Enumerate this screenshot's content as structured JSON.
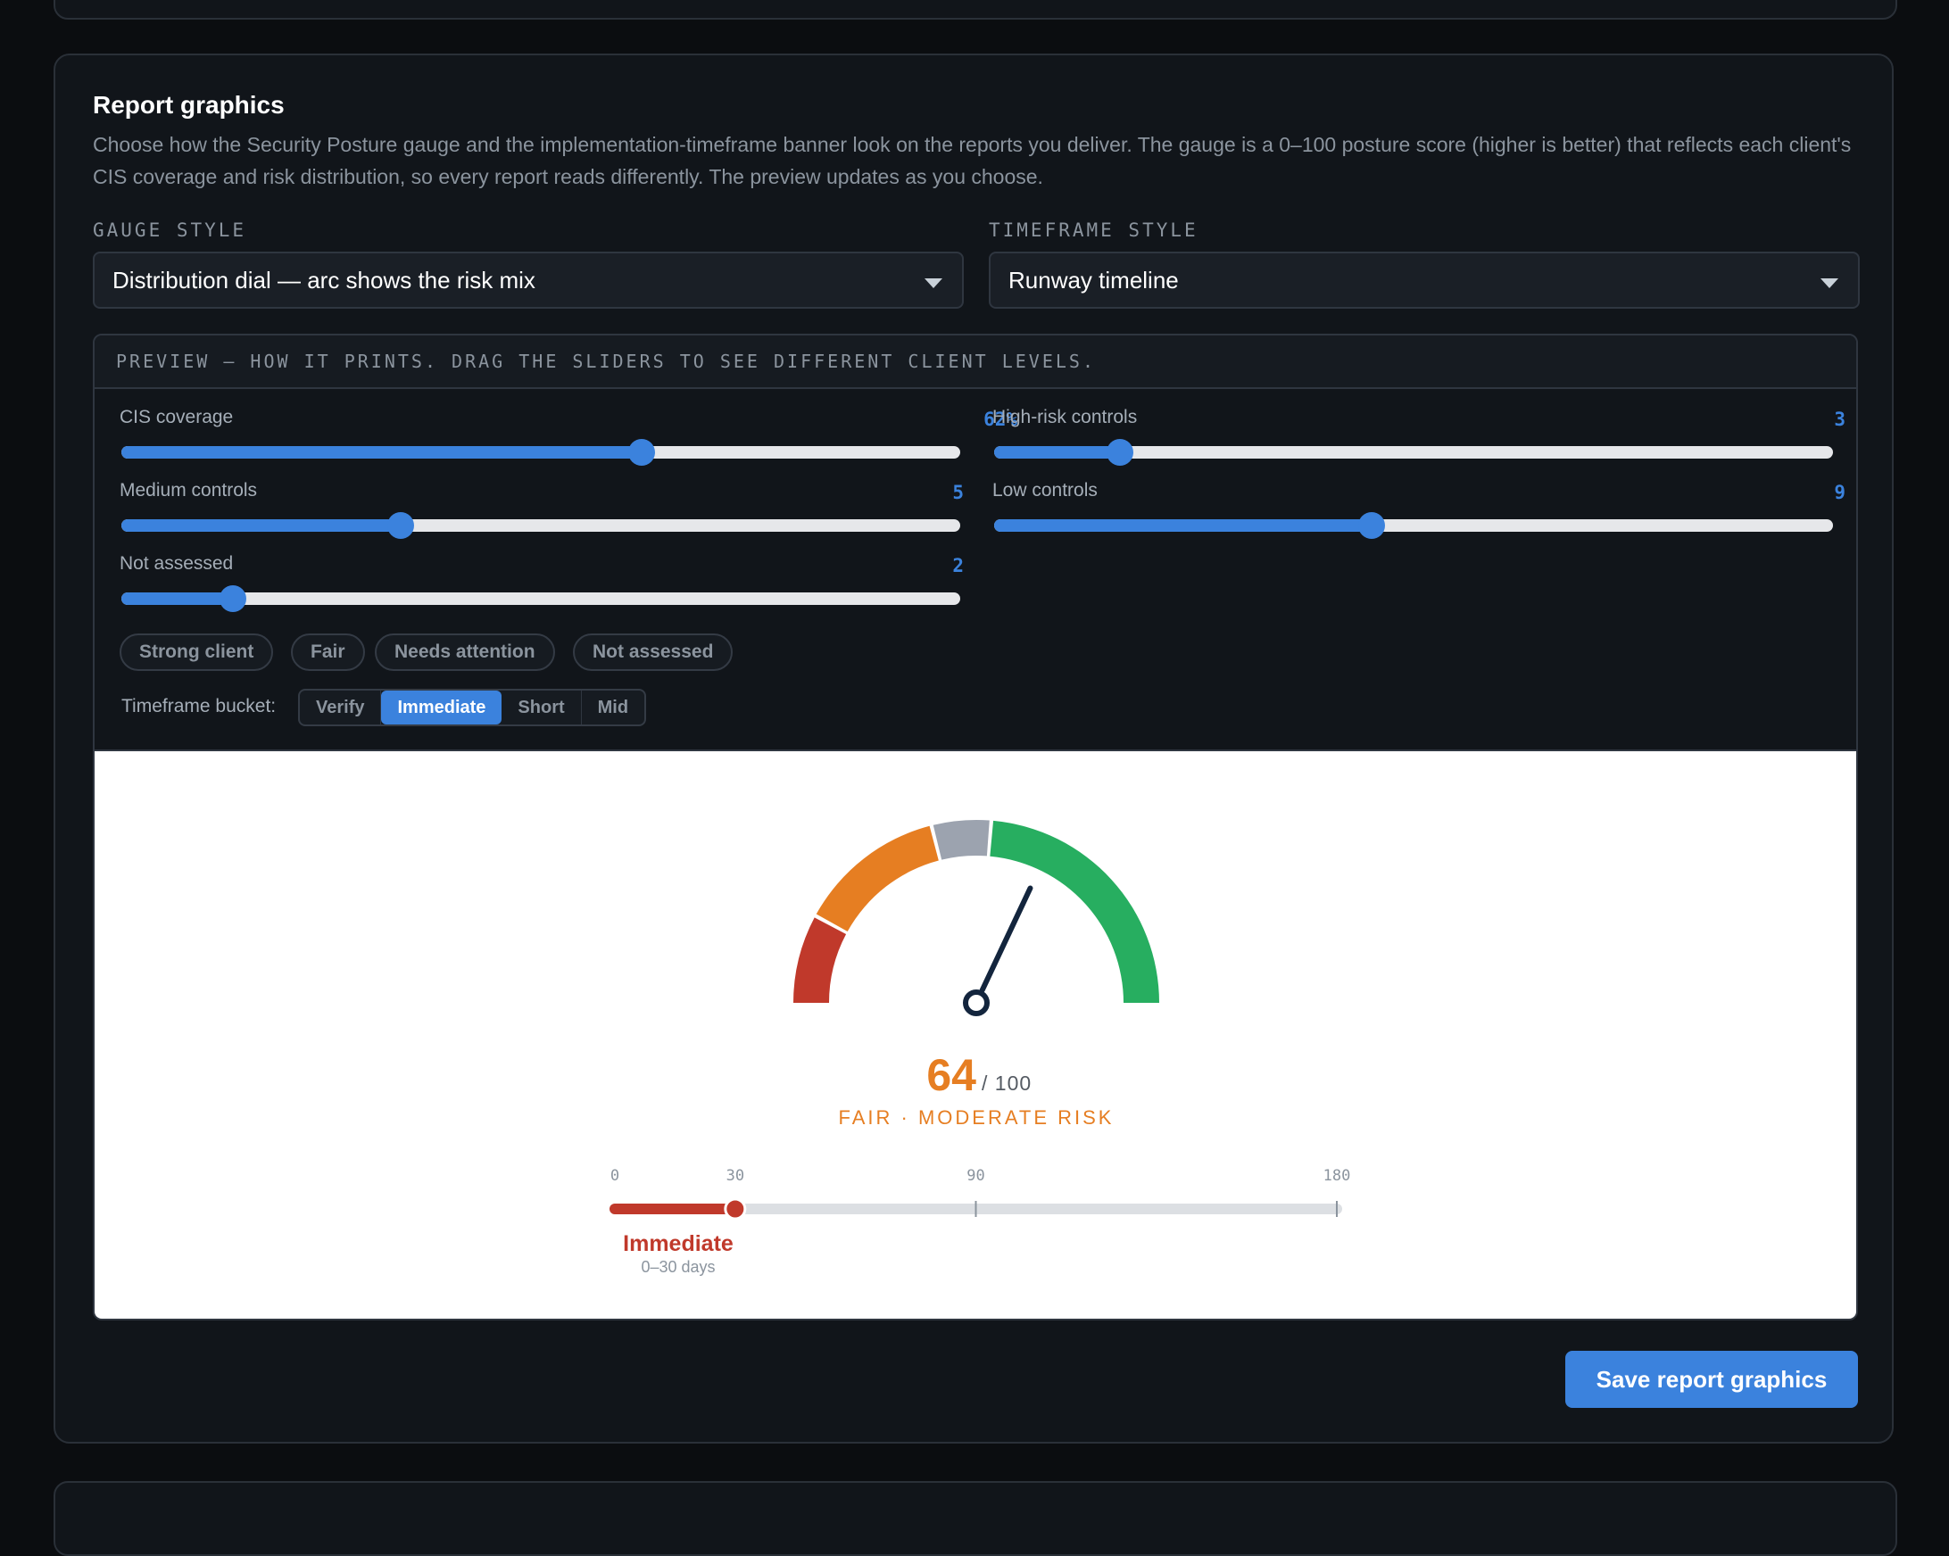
{
  "section": {
    "title": "Report graphics",
    "description": "Choose how the Security Posture gauge and the implementation-timeframe banner look on the reports you deliver. The gauge is a 0–100 posture score (higher is better) that reflects each client's CIS coverage and risk distribution, so every report reads differently. The preview updates as you choose."
  },
  "gauge_style": {
    "label": "GAUGE STYLE",
    "value": "Distribution dial — arc shows the risk mix"
  },
  "timeframe_style": {
    "label": "TIMEFRAME STYLE",
    "value": "Runway timeline"
  },
  "preview": {
    "heading": "PREVIEW — HOW IT PRINTS. DRAG THE SLIDERS TO SEE DIFFERENT CLIENT LEVELS.",
    "sliders": {
      "cis": {
        "label": "CIS coverage",
        "display": "62%",
        "value": 62,
        "max": 100
      },
      "high": {
        "label": "High-risk controls",
        "display": "3",
        "value": 3,
        "max": 20
      },
      "medium": {
        "label": "Medium controls",
        "display": "5",
        "value": 5,
        "max": 15
      },
      "low": {
        "label": "Low controls",
        "display": "9",
        "value": 9,
        "max": 20
      },
      "not_assessed": {
        "label": "Not assessed",
        "display": "2",
        "value": 2,
        "max": 15
      }
    },
    "presets": [
      "Strong client",
      "Fair",
      "Needs attention",
      "Not assessed"
    ],
    "timeframe_bucket": {
      "label": "Timeframe bucket:",
      "options": [
        "Verify",
        "Immediate",
        "Short",
        "Mid"
      ],
      "selected": "Immediate"
    }
  },
  "gauge": {
    "score": "64",
    "max_label": "/ 100",
    "rating": "FAIR · MODERATE RISK",
    "score_value": 64,
    "segments": [
      {
        "name": "high",
        "color": "#c0392b"
      },
      {
        "name": "medium",
        "color": "#e67e22"
      },
      {
        "name": "not-assessed",
        "color": "#9ca3af"
      },
      {
        "name": "low",
        "color": "#27ae60"
      }
    ],
    "needle_color": "#13253d",
    "score_color": "#e67e22"
  },
  "timeline": {
    "ticks": [
      "0",
      "30",
      "90",
      "180"
    ],
    "tick_values": [
      0,
      30,
      90,
      180
    ],
    "range_end": 30,
    "bucket_label": "Immediate",
    "bucket_range": "0–30 days",
    "color": "#c0392b"
  },
  "save_button": "Save report graphics"
}
